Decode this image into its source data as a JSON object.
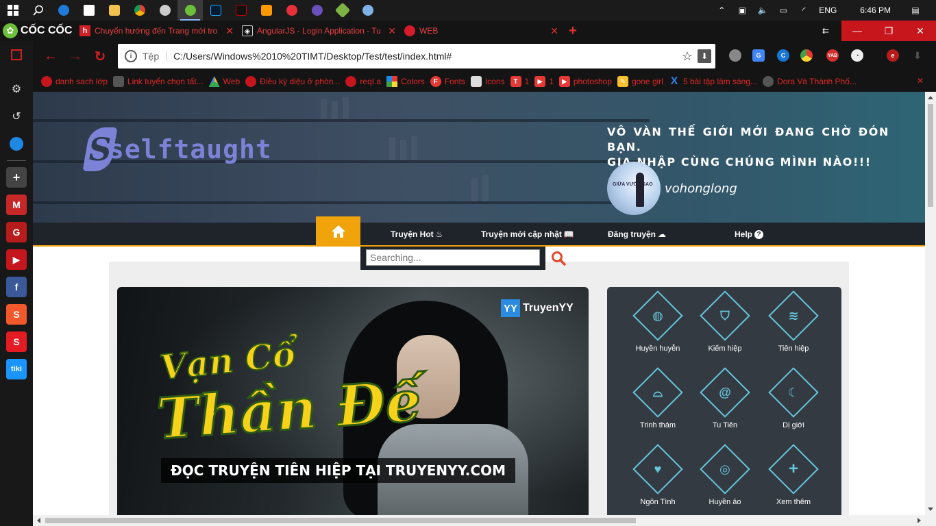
{
  "taskbar": {
    "clock": "6:46 PM",
    "language": "ENG"
  },
  "browser": {
    "brand": "CỐC CỐC",
    "tabs": [
      {
        "title": "Chuyển hướng đến Trang mới tro",
        "favicon": "h"
      },
      {
        "title": "AngularJS - Login Application - Tu",
        "favicon": "angular-icon"
      },
      {
        "title": "WEB",
        "favicon": "opera-icon"
      }
    ],
    "address": {
      "scheme_label": "Tệp",
      "url": "C:/Users/Windows%2010%20TIMT/Desktop/Test/test/index.html#"
    },
    "bookmarks": [
      "danh sach lớp",
      "Link tuyển chọn tất...",
      "Web",
      "Điều kỳ diệu ở phòn...",
      "reqI.a",
      "Colors",
      "Fonts",
      "Icons",
      "1",
      "1",
      "photoshop",
      "gone girl",
      "5 bài tập làm sáng...",
      "Dora Và Thành Phố..."
    ]
  },
  "site": {
    "logo_letter": "S",
    "logo_text": "selftaught",
    "slogan_line1": "VÔ VÀN THẾ GIỚI MỚI ĐANG CHỜ ĐÓN BẠN.",
    "slogan_line2": "GIA NHẬP CÙNG CHÚNG MÌNH NÀO!!!",
    "username": "vohonglong",
    "avatar_text": "GIỮA VƯỜN SAO",
    "nav": [
      {
        "label": "Truyện Hot",
        "icon": "fire-icon"
      },
      {
        "label": "Truyện mới cập nhật",
        "icon": "book-icon"
      },
      {
        "label": "Đăng truyện",
        "icon": "cloud-upload-icon"
      },
      {
        "label": "Help",
        "icon": "question-icon"
      }
    ],
    "search_placeholder": "Searching...",
    "hero": {
      "title_top": "Vạn Cổ",
      "title_main": "Thần Đế",
      "caption": "ĐỌC TRUYỆN TIÊN HIỆP TẠI TRUYENYY.COM",
      "brand_badge": "YY",
      "brand_name": "TruyenYY"
    },
    "genres": [
      {
        "label": "Huyền huyễn",
        "icon": "globe-icon"
      },
      {
        "label": "Kiếm hiệp",
        "icon": "shield-icon"
      },
      {
        "label": "Tiên hiệp",
        "icon": "dragon-icon"
      },
      {
        "label": "Trinh thám",
        "icon": "hat-icon"
      },
      {
        "label": "Tu Tiên",
        "icon": "swirl-icon"
      },
      {
        "label": "Dị giới",
        "icon": "moon-icon"
      },
      {
        "label": "Ngôn Tình",
        "icon": "heart-icon"
      },
      {
        "label": "Huyền ảo",
        "icon": "target-icon"
      },
      {
        "label": "Xem thêm",
        "icon": "plus-icon"
      }
    ]
  },
  "colors": {
    "accent": "#f0a30a",
    "genre_line": "#67c7dc",
    "browser_red": "#e02828"
  }
}
